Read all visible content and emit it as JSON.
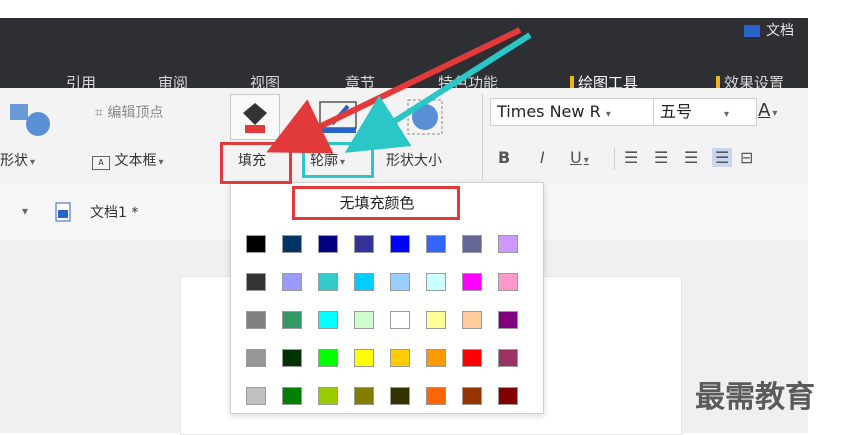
{
  "window": {
    "title": "文档"
  },
  "tabs": [
    {
      "label": "引用",
      "active": false
    },
    {
      "label": "审阅",
      "active": false
    },
    {
      "label": "视图",
      "active": false
    },
    {
      "label": "章节",
      "active": false
    },
    {
      "label": "特色功能",
      "active": false
    },
    {
      "label": "绘图工具",
      "active": true
    },
    {
      "label": "效果设置",
      "active": false
    }
  ],
  "ribbon": {
    "edit_vertex": "编辑顶点",
    "shape_label": "形状",
    "textbox_label": "文本框",
    "fill_label": "填充",
    "outline_label": "轮廓",
    "shape_size_label": "形状大小",
    "font_name": "Times New R",
    "font_size": "五号",
    "fmt_b": "B",
    "fmt_i": "I",
    "fmt_u": "U"
  },
  "document": {
    "tab_title": "文档1 *"
  },
  "dropdown": {
    "no_fill_label": "无填充颜色",
    "colors": [
      [
        "#000000",
        "#003366",
        "#000080",
        "#333399",
        "#0000ff",
        "#3366ff",
        "#666699",
        "#cc99ff"
      ],
      [
        "#333333",
        "#9999ff",
        "#33cccc",
        "#00ccff",
        "#99ccff",
        "#ccffff",
        "#ff00ff",
        "#ff99cc"
      ],
      [
        "#808080",
        "#339966",
        "#00ffff",
        "#ccffcc",
        "#ffffff",
        "#ffff99",
        "#ffcc99",
        "#800080"
      ],
      [
        "#969696",
        "#003300",
        "#00ff00",
        "#ffff00",
        "#ffcc00",
        "#ff9900",
        "#ff0000",
        "#993366"
      ],
      [
        "#c0c0c0",
        "#008000",
        "#99cc00",
        "#808000",
        "#333300",
        "#ff6600",
        "#993300",
        "#800000"
      ]
    ]
  },
  "watermark": {
    "text": "最需教育"
  },
  "colors": {
    "highlight_red": "#e23a3a",
    "highlight_cyan": "#2bc6c8",
    "active_tab_bar": "#f2b51c"
  }
}
